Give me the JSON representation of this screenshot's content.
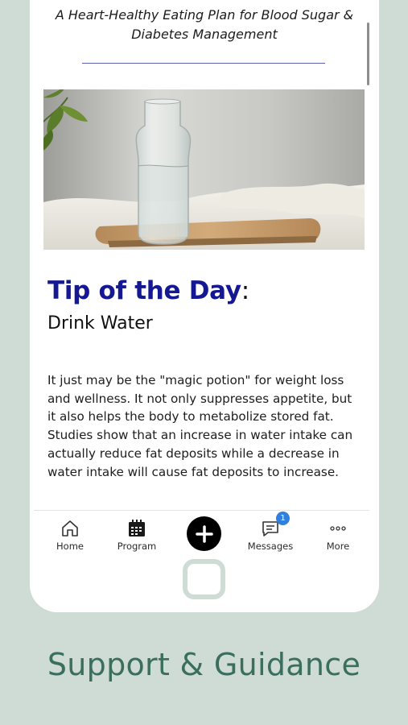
{
  "article": {
    "subtitle": "A Heart-Healthy Eating Plan for Blood Sugar & Diabetes Management",
    "tip_heading": "Tip of the Day",
    "tip_colon": ":",
    "tip_title": "Drink Water",
    "tip_body": "It just may be the \"magic potion\" for weight loss and wellness.  It not only suppresses appetite, but it also helps the body to metabolize stored fat.  Studies show that an increase in water intake can actually reduce fat deposits while a decrease in water intake will cause fat deposits to increase."
  },
  "nav": {
    "home": "Home",
    "program": "Program",
    "messages": "Messages",
    "messages_badge": "1",
    "more": "More"
  },
  "tagline": "Support & Guidance",
  "colors": {
    "heading": "#141892",
    "tagline": "#3a6e5e",
    "background": "#cfdcd6",
    "badge": "#2f80e0"
  }
}
